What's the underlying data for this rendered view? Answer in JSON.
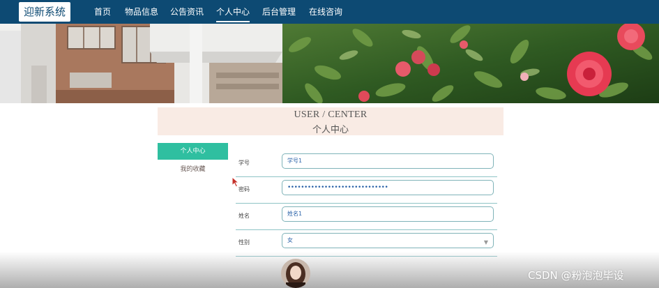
{
  "nav": {
    "brand": "迎新系统",
    "items": [
      {
        "label": "首页",
        "active": false
      },
      {
        "label": "物品信息",
        "active": false
      },
      {
        "label": "公告资讯",
        "active": false
      },
      {
        "label": "个人中心",
        "active": true
      },
      {
        "label": "后台管理",
        "active": false
      },
      {
        "label": "在线咨询",
        "active": false
      }
    ]
  },
  "section": {
    "title_en": "USER / CENTER",
    "title_cn": "个人中心"
  },
  "side_menu": [
    {
      "label": "个人中心",
      "active": true
    },
    {
      "label": "我的收藏",
      "active": false
    }
  ],
  "form": {
    "fields": [
      {
        "label": "学号",
        "value": "学号1"
      },
      {
        "label": "密码",
        "value": "••••••••••••••••••••••••••••••"
      },
      {
        "label": "姓名",
        "value": "姓名1"
      },
      {
        "label": "性别",
        "value": "女"
      }
    ]
  },
  "watermark": "CSDN @粉泡泡毕设",
  "colors": {
    "nav_bg": "#0d4a73",
    "accent": "#2fbfa0",
    "title_bg": "#f9ebe4",
    "input_border": "#7fb3b8"
  },
  "icons": {
    "select_arrow": "chevron-down-icon",
    "cursor": "mouse-pointer-icon"
  }
}
